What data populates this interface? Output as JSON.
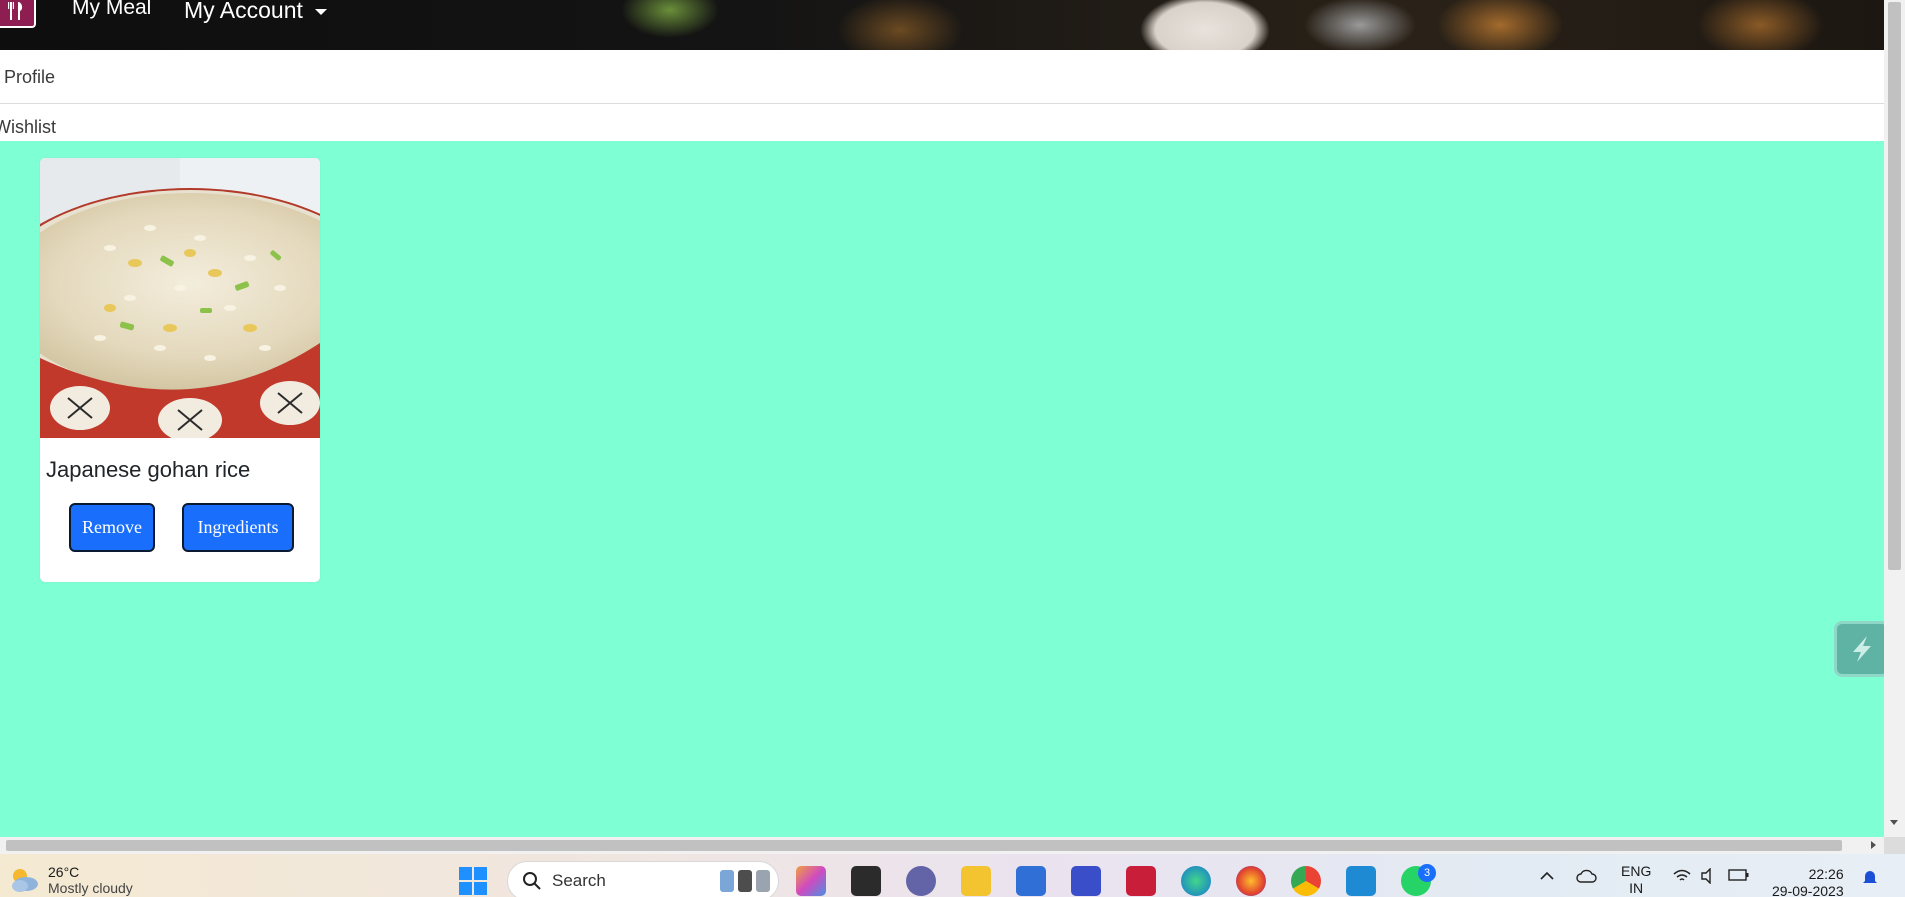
{
  "navbar": {
    "brand": "My Meal",
    "account_label": "My Account"
  },
  "profile_link": "Profile",
  "wishlist_title": "Wishlist",
  "wishlist": [
    {
      "title": "Japanese gohan rice",
      "remove_label": "Remove",
      "ingredients_label": "Ingredients"
    }
  ],
  "taskbar": {
    "weather": {
      "temperature": "26°C",
      "condition": "Mostly cloudy"
    },
    "search_placeholder": "Search",
    "whatsapp_badge": "3",
    "language": {
      "line1": "ENG",
      "line2": "IN"
    },
    "time": "22:26",
    "date": "29-09-2023"
  },
  "colors": {
    "page_background": "#7fffd4",
    "button_primary": "#1a6efc",
    "brand_logo": "#8e1d52"
  }
}
